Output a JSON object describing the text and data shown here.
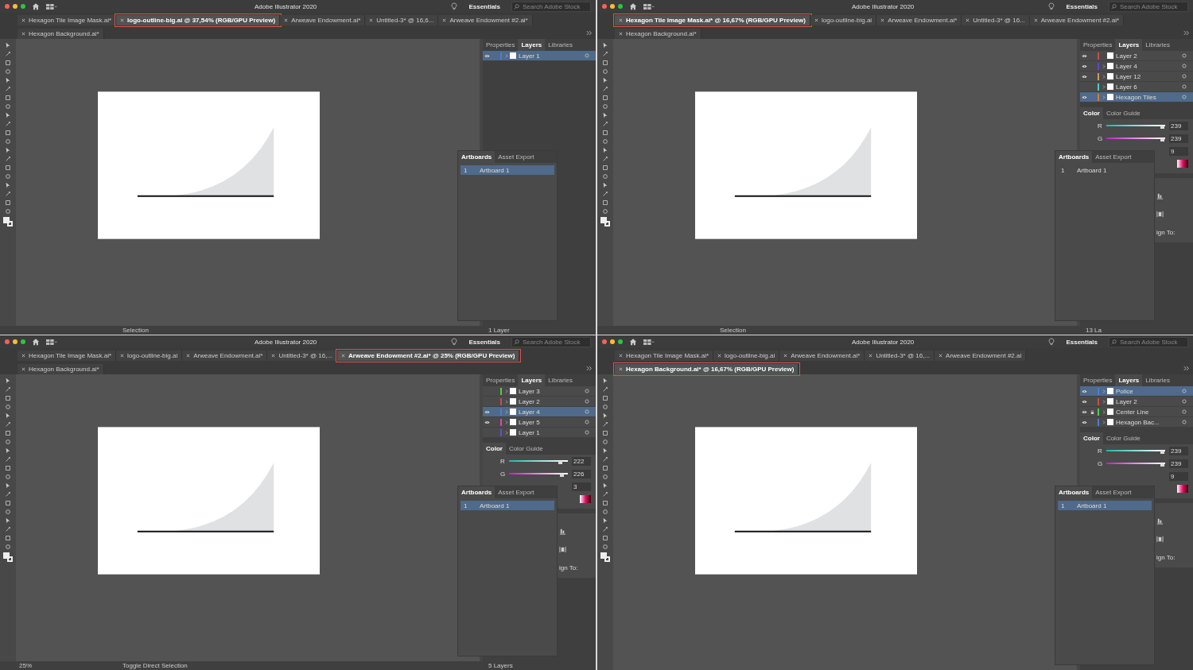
{
  "windows": [
    {
      "app_title": "Adobe Illustrator 2020",
      "workspace": "Essentials",
      "search_placeholder": "Search Adobe Stock",
      "tabs": [
        {
          "label": "Hexagon Tile Image Mask.ai*",
          "selected": false
        },
        {
          "label": "logo-outline-big.ai @ 37,54% (RGB/GPU Preview)",
          "selected": true
        },
        {
          "label": "Arweave Endowment.ai*",
          "selected": false
        },
        {
          "label": "Untitled-3* @ 16,6...",
          "selected": false
        },
        {
          "label": "Arweave Endowment #2.ai*",
          "selected": false
        },
        {
          "label": "Hexagon Background.ai*",
          "selected": false
        }
      ],
      "panel_tabs": [
        {
          "label": "Properties",
          "selected": false
        },
        {
          "label": "Layers",
          "selected": true
        },
        {
          "label": "Libraries",
          "selected": false
        }
      ],
      "layers": [
        {
          "name": "Layer 1",
          "visible": true,
          "expandable": true,
          "color": "#4a7fd0",
          "selected": true
        }
      ],
      "artboard_tabs": [
        {
          "label": "Artboards",
          "selected": true
        },
        {
          "label": "Asset Export",
          "selected": false
        }
      ],
      "artboards": [
        {
          "number": "1",
          "name": "Artboard 1",
          "selected": true
        }
      ],
      "status": {
        "tool": "Selection",
        "layer_count": "1 Layer"
      }
    },
    {
      "app_title": "Adobe Illustrator 2020",
      "workspace": "Essentials",
      "search_placeholder": "Search Adobe Stock",
      "tabs": [
        {
          "label": "Hexagon Tile Image Mask.ai* @ 16,67% (RGB/GPU Preview)",
          "selected": true
        },
        {
          "label": "logo-outline-big.ai",
          "selected": false
        },
        {
          "label": "Arweave Endowment.ai*",
          "selected": false
        },
        {
          "label": "Untitled-3* @ 16...",
          "selected": false
        },
        {
          "label": "Arweave Endowment #2.ai*",
          "selected": false
        },
        {
          "label": "Hexagon Background.ai*",
          "selected": false
        }
      ],
      "panel_tabs": [
        {
          "label": "Properties",
          "selected": false
        },
        {
          "label": "Layers",
          "selected": true
        },
        {
          "label": "Libraries",
          "selected": false
        }
      ],
      "layers": [
        {
          "name": "Layer 2",
          "visible": true,
          "expandable": false,
          "color": "#d04a4a",
          "selected": false
        },
        {
          "name": "Layer 4",
          "visible": true,
          "expandable": true,
          "color": "#5a4ad0",
          "selected": false
        },
        {
          "name": "Layer 12",
          "visible": true,
          "expandable": true,
          "color": "#d09a5a",
          "selected": false
        },
        {
          "name": "Layer 6",
          "visible": false,
          "expandable": true,
          "color": "#4ad0c8",
          "selected": false
        },
        {
          "name": "Hexagon Tiles",
          "visible": true,
          "expandable": true,
          "color": "#e07a30",
          "selected": true
        }
      ],
      "color_panel": {
        "tabs": [
          {
            "label": "Color",
            "selected": true
          },
          {
            "label": "Color Guide",
            "selected": false
          }
        ],
        "channels": [
          {
            "name": "R",
            "value": "239",
            "level": 0.94
          },
          {
            "name": "G",
            "value": "239",
            "level": 0.94
          }
        ],
        "hidden_value": "9"
      },
      "align_fragment": "ign To:",
      "artboard_tabs": [
        {
          "label": "Artboards",
          "selected": true
        },
        {
          "label": "Asset Export",
          "selected": false
        }
      ],
      "artboards": [
        {
          "number": "1",
          "name": "Artboard 1",
          "selected": false
        }
      ],
      "status": {
        "tool": "Selection",
        "layer_count": "13 La"
      }
    },
    {
      "app_title": "Adobe Illustrator 2020",
      "workspace": "Essentials",
      "search_placeholder": "Search Adobe Stock",
      "tabs": [
        {
          "label": "Hexagon Tile Image Mask.ai*",
          "selected": false
        },
        {
          "label": "logo-outline-big.ai",
          "selected": false
        },
        {
          "label": "Arweave Endowment.ai*",
          "selected": false
        },
        {
          "label": "Untitled-3* @ 16,...",
          "selected": false
        },
        {
          "label": "Arweave Endowment #2.ai* @ 25% (RGB/GPU Preview)",
          "selected": true
        },
        {
          "label": "Hexagon Background.ai*",
          "selected": false
        }
      ],
      "panel_tabs": [
        {
          "label": "Properties",
          "selected": false
        },
        {
          "label": "Layers",
          "selected": true
        },
        {
          "label": "Libraries",
          "selected": false
        }
      ],
      "layers": [
        {
          "name": "Layer 3",
          "visible": false,
          "expandable": true,
          "color": "#4ad04a",
          "selected": false
        },
        {
          "name": "Layer 2",
          "visible": false,
          "expandable": true,
          "color": "#d04a4a",
          "selected": false
        },
        {
          "name": "Layer 4",
          "visible": true,
          "expandable": true,
          "color": "#4a7fd0",
          "selected": true
        },
        {
          "name": "Layer 5",
          "visible": true,
          "expandable": true,
          "color": "#d04ab0",
          "selected": false
        },
        {
          "name": "Layer 1",
          "visible": false,
          "expandable": true,
          "color": "#6a4ad0",
          "selected": false
        }
      ],
      "color_panel": {
        "tabs": [
          {
            "label": "Color",
            "selected": true
          },
          {
            "label": "Color Guide",
            "selected": false
          }
        ],
        "channels": [
          {
            "name": "R",
            "value": "222",
            "level": 0.87
          },
          {
            "name": "G",
            "value": "226",
            "level": 0.89
          }
        ],
        "hidden_value": "3"
      },
      "align_fragment": "ign To:",
      "artboard_tabs": [
        {
          "label": "Artboards",
          "selected": true
        },
        {
          "label": "Asset Export",
          "selected": false
        }
      ],
      "artboards": [
        {
          "number": "1",
          "name": "Artboard 1",
          "selected": true
        }
      ],
      "status": {
        "zoom": "25%",
        "tool": "Toggle Direct Selection",
        "layer_count": "5 Layers"
      }
    },
    {
      "app_title": "Adobe Illustrator 2020",
      "workspace": "Essentials",
      "search_placeholder": "Search Adobe Stock",
      "tabs": [
        {
          "label": "Hexagon Tile Image Mask.ai*",
          "selected": false
        },
        {
          "label": "logo-outline-big.ai",
          "selected": false
        },
        {
          "label": "Arweave Endowment.ai*",
          "selected": false
        },
        {
          "label": "Untitled-3* @ 16,...",
          "selected": false
        },
        {
          "label": "Arweave Endowment #2.ai",
          "selected": false
        },
        {
          "label": "Hexagon Background.ai* @ 16,67% (RGB/GPU Preview)",
          "selected": true
        }
      ],
      "panel_tabs": [
        {
          "label": "Properties",
          "selected": false
        },
        {
          "label": "Layers",
          "selected": true
        },
        {
          "label": "Libraries",
          "selected": false
        }
      ],
      "layers": [
        {
          "name": "Police",
          "visible": true,
          "locked": false,
          "expandable": true,
          "color": "#4a7fd0",
          "selected": true
        },
        {
          "name": "Layer 2",
          "visible": true,
          "locked": false,
          "expandable": true,
          "color": "#d04a4a",
          "selected": false
        },
        {
          "name": "Center Line",
          "visible": true,
          "locked": true,
          "expandable": true,
          "color": "#4ad04a",
          "selected": false
        },
        {
          "name": "Hexagon Bac...",
          "visible": true,
          "locked": false,
          "expandable": true,
          "color": "#4a7fd0",
          "selected": false
        }
      ],
      "color_panel": {
        "tabs": [
          {
            "label": "Color",
            "selected": true
          },
          {
            "label": "Color Guide",
            "selected": false
          }
        ],
        "channels": [
          {
            "name": "R",
            "value": "239",
            "level": 0.94
          },
          {
            "name": "G",
            "value": "239",
            "level": 0.94
          }
        ],
        "hidden_value": "9"
      },
      "align_fragment": "ign To:",
      "artboard_tabs": [
        {
          "label": "Artboards",
          "selected": true
        },
        {
          "label": "Asset Export",
          "selected": false
        }
      ],
      "artboards": [
        {
          "number": "1",
          "name": "Artboard 1",
          "selected": true
        }
      ]
    }
  ]
}
